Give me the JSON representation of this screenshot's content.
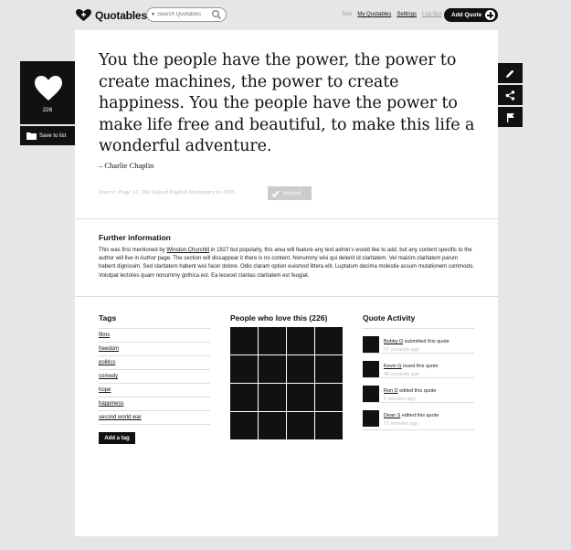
{
  "header": {
    "brand": "Quotables",
    "search_placeholder": "Search Quotables",
    "user": "Tom",
    "nav": [
      "My Quotables",
      "Settings",
      "Log Out"
    ],
    "add_quote_label": "Add Quote"
  },
  "quote": {
    "text": "You the people have the power, the power to create machines, the power to create happiness. You the people have the power to make life free and beautiful, to make this life a wonderful adventure.",
    "author": "– Charlie Chaplin",
    "source": "Source: Page 12, The Oxford English Dictionary in 1935",
    "verified_label": "Verified"
  },
  "love": {
    "count": "226",
    "save_label": "Save to list"
  },
  "further": {
    "title": "Further information",
    "prefix": "This was first mentioned by ",
    "link": "Winston Churchill",
    "suffix": " in 1927 but popularly, this area will feature any text admin's would like to add, but any content specific to the author will live in Author page. The section will dissappear it there is no content. Nonummy wisi qui delenit id claritatem. Vel maizim claritatem parum habent dignissim. Sed claritatem habent wisi facer dolore. Odio claram option euismod littera elit. Luptatum decima molestie assum mutationem commodo. Volutpat lectores quam nonummy gothica est. Ea lececet claritas claritatem est feugiat."
  },
  "tags": {
    "title": "Tags",
    "items": [
      "films",
      "freedom",
      "politics",
      "comedy",
      "hope",
      "happiness",
      "second world war"
    ],
    "add_label": "Add a tag"
  },
  "lovers": {
    "title": "People who love this (226)"
  },
  "activity": {
    "title": "Quote Activity",
    "items": [
      {
        "user": "Bobby D",
        "action": " submitted this quote",
        "time": "37 seconds ago"
      },
      {
        "user": "Kevin G",
        "action": " loved this quote",
        "time": "48 seconds ago"
      },
      {
        "user": "Ron D",
        "action": " edited this quote",
        "time": "5 minutes ago"
      },
      {
        "user": "Dean S",
        "action": " edited this quote",
        "time": "17 minutes ago"
      }
    ]
  },
  "icons": {
    "brand": "heart-icon",
    "side": [
      "pencil-icon",
      "share-icon",
      "flag-icon"
    ]
  },
  "colors": {
    "ink": "#111111",
    "page": "#e6e6e6",
    "card": "#ffffff",
    "muted": "#bbbbbb"
  }
}
